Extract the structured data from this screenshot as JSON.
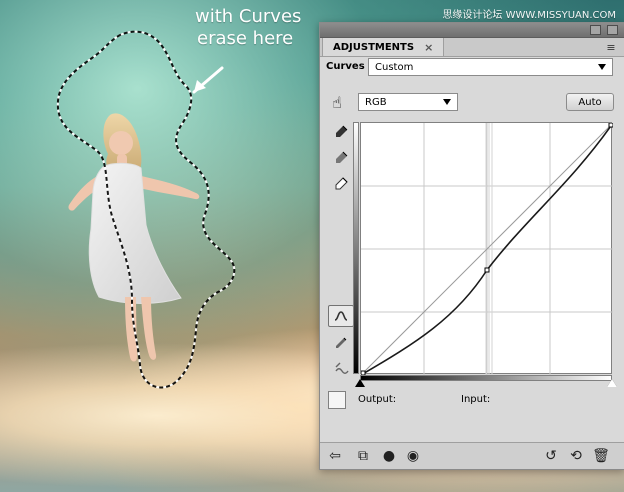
{
  "watermark": "思缘设计论坛 WWW.MISSYUAN.COM",
  "annotation": {
    "line1": "with Curves",
    "line2": "erase here"
  },
  "panel": {
    "tab_label": "ADJUSTMENTS",
    "curves_label": "Curves",
    "preset_value": "Custom",
    "channel_value": "RGB",
    "auto_label": "Auto",
    "output_label": "Output:",
    "input_label": "Input:"
  }
}
